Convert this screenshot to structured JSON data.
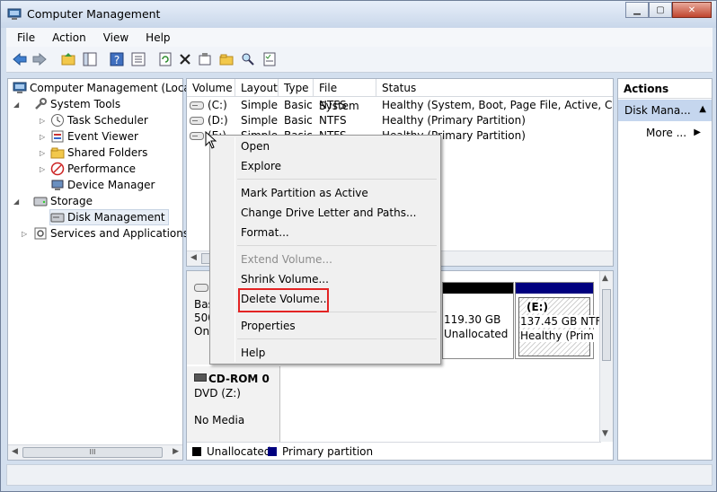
{
  "window": {
    "title": "Computer Management"
  },
  "menu": [
    "File",
    "Action",
    "View",
    "Help"
  ],
  "tree": {
    "root": "Computer Management (Local",
    "system_tools": "System Tools",
    "task_scheduler": "Task Scheduler",
    "event_viewer": "Event Viewer",
    "shared_folders": "Shared Folders",
    "performance": "Performance",
    "device_manager": "Device Manager",
    "storage": "Storage",
    "disk_management": "Disk Management",
    "services": "Services and Applications",
    "scroll_mark": "III"
  },
  "volume_table": {
    "columns": [
      "Volume",
      "Layout",
      "Type",
      "File System",
      "Status"
    ],
    "rows": [
      [
        "(C:)",
        "Simple",
        "Basic",
        "NTFS",
        "Healthy (System, Boot, Page File, Active, Crash D"
      ],
      [
        "(D:)",
        "Simple",
        "Basic",
        "NTFS",
        "Healthy (Primary Partition)"
      ],
      [
        "(E:)",
        "Simple",
        "Basic",
        "NTFS",
        "Healthy (Primary Partition)"
      ]
    ]
  },
  "disk_view": {
    "disk0": {
      "line1": "Bas",
      "line2": "500",
      "line3": "On"
    },
    "unallocated": {
      "size": "119.30 GB",
      "label": "Unallocated"
    },
    "partition_e": {
      "name": "(E:)",
      "size": "137.45 GB NTF",
      "status": "Healthy (Prim"
    },
    "cdrom": {
      "title": "CD-ROM 0",
      "drive": "DVD (Z:)",
      "media": "No Media"
    },
    "legend": {
      "unallocated": "Unallocated",
      "primary": "Primary partition"
    }
  },
  "actions": {
    "header": "Actions",
    "section": "Disk Mana...",
    "more": "More ..."
  },
  "context_menu": {
    "open": "Open",
    "explore": "Explore",
    "mark_active": "Mark Partition as Active",
    "change_letter": "Change Drive Letter and Paths...",
    "format": "Format...",
    "extend": "Extend Volume...",
    "shrink": "Shrink Volume...",
    "delete": "Delete Volume...",
    "properties": "Properties",
    "help": "Help"
  },
  "colors": {
    "unallocated": "#000000",
    "primary_partition": "#00007f",
    "highlight_box": "#e32424",
    "actions_selected": "#c5d6ee"
  }
}
